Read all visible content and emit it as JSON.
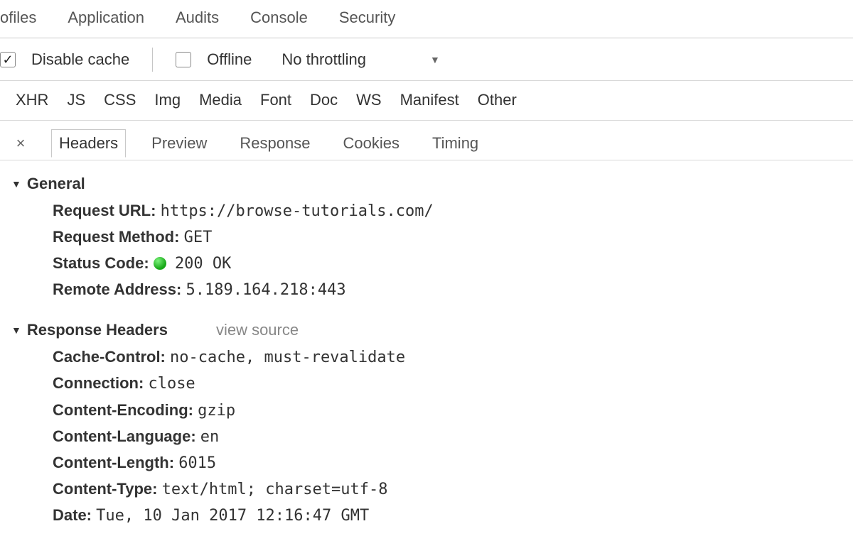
{
  "topTabs": [
    "ofiles",
    "Application",
    "Audits",
    "Console",
    "Security"
  ],
  "toolbar": {
    "disable_cache_label": "Disable cache",
    "disable_cache_checked": true,
    "offline_label": "Offline",
    "offline_checked": false,
    "throttling_label": "No throttling"
  },
  "filters": [
    "XHR",
    "JS",
    "CSS",
    "Img",
    "Media",
    "Font",
    "Doc",
    "WS",
    "Manifest",
    "Other"
  ],
  "subTabs": [
    "Headers",
    "Preview",
    "Response",
    "Cookies",
    "Timing"
  ],
  "activeSubTab": "Headers",
  "sections": {
    "general": {
      "title": "General",
      "rows": [
        {
          "key": "Request URL:",
          "value": "https://browse-tutorials.com/"
        },
        {
          "key": "Request Method:",
          "value": "GET"
        },
        {
          "key": "Status Code:",
          "value": "200 OK",
          "status_dot": true
        },
        {
          "key": "Remote Address:",
          "value": "5.189.164.218:443"
        }
      ]
    },
    "response_headers": {
      "title": "Response Headers",
      "view_source": "view source",
      "rows": [
        {
          "key": "Cache-Control:",
          "value": "no-cache, must-revalidate"
        },
        {
          "key": "Connection:",
          "value": "close"
        },
        {
          "key": "Content-Encoding:",
          "value": "gzip"
        },
        {
          "key": "Content-Language:",
          "value": "en"
        },
        {
          "key": "Content-Length:",
          "value": "6015"
        },
        {
          "key": "Content-Type:",
          "value": "text/html; charset=utf-8"
        },
        {
          "key": "Date:",
          "value": "Tue, 10 Jan 2017 12:16:47 GMT"
        }
      ]
    }
  }
}
